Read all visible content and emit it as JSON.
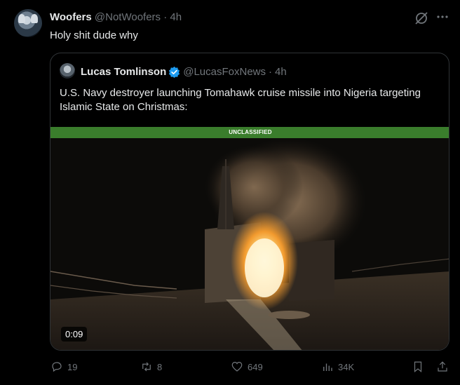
{
  "tweet": {
    "display_name": "Woofers",
    "handle": "@NotWoofers",
    "separator": "·",
    "time": "4h",
    "text": "Holy shit dude why"
  },
  "quoted": {
    "display_name": "Lucas Tomlinson",
    "handle": "@LucasFoxNews",
    "separator": "·",
    "time": "4h",
    "text": "U.S. Navy destroyer launching Tomahawk cruise missile into Nigeria targeting Islamic State on Christmas:",
    "media": {
      "banner": "UNCLASSIFIED",
      "duration": "0:09"
    }
  },
  "actions": {
    "replies": "19",
    "reposts": "8",
    "likes": "649",
    "views": "34K"
  },
  "colors": {
    "background": "#000000",
    "text": "#e7e9ea",
    "muted": "#71767b",
    "verified": "#1d9bf0",
    "banner": "#3a7d2c"
  },
  "icons": [
    "grok-icon",
    "more-icon",
    "verified-badge-icon",
    "reply-icon",
    "repost-icon",
    "like-icon",
    "views-icon",
    "bookmark-icon",
    "share-icon"
  ]
}
